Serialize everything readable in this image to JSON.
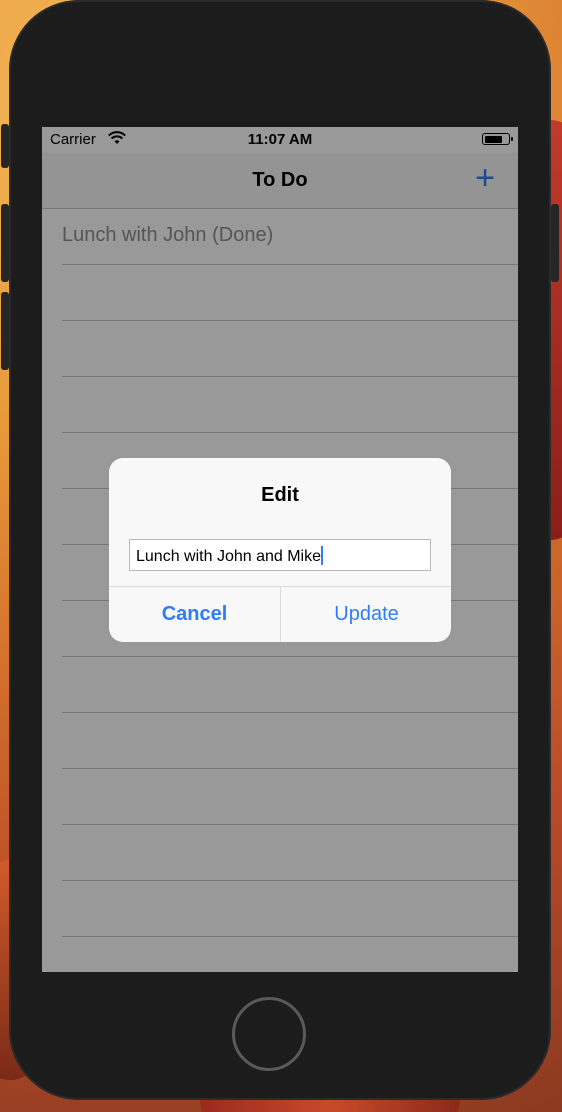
{
  "status_bar": {
    "carrier": "Carrier",
    "time": "11:07 AM",
    "battery_level": 0.75
  },
  "nav": {
    "title": "To Do",
    "add_icon": "+"
  },
  "todo_items": [
    "Lunch with John (Done)"
  ],
  "alert": {
    "title": "Edit",
    "input_value": "Lunch with John and Mike",
    "cancel_label": "Cancel",
    "update_label": "Update"
  },
  "colors": {
    "accent": "#2f7cf6",
    "separator": "#c8c7cc"
  }
}
